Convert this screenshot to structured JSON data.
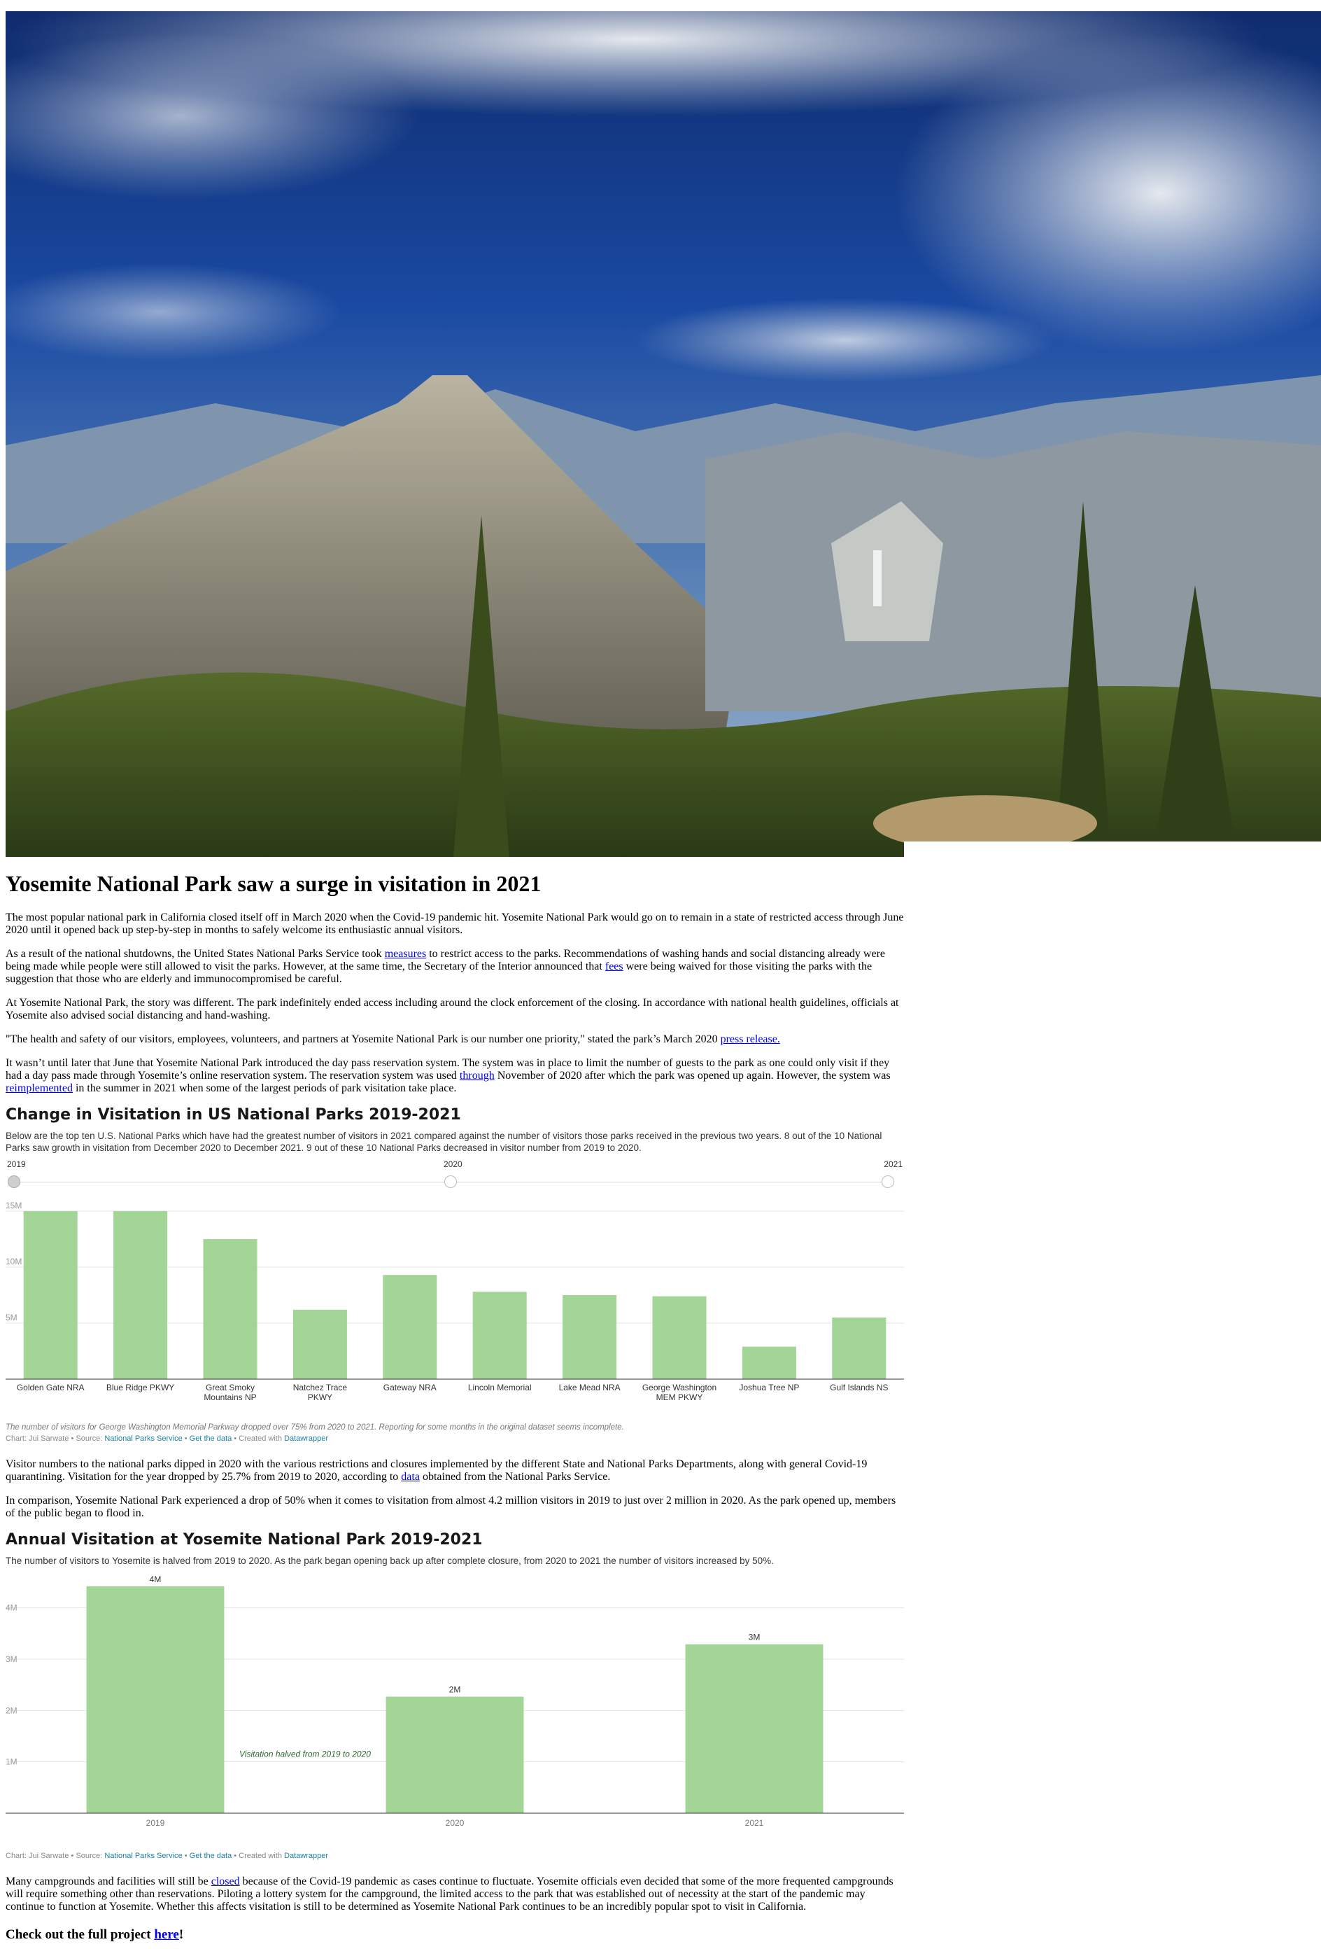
{
  "article": {
    "title": "Yosemite National Park saw a surge in visitation in 2021",
    "p1": "The most popular national park in California closed itself off in March 2020 when the Covid-19 pandemic hit. Yosemite National Park would go on to remain in a state of restricted access through June 2020 until it opened back up step-by-step in months to safely welcome its enthusiastic annual visitors.",
    "p2": {
      "a": "As a result of the national shutdowns, the United States National Parks Service took ",
      "link1": "measures",
      "b": " to restrict access to the parks. Recommendations of washing hands and social distancing already were being made while people were still allowed to visit the parks. However, at the same time, the Secretary of the Interior announced that ",
      "link2": "fees",
      "c": " were being waived for those visiting the parks with the suggestion that those who are elderly and immunocompromised be careful."
    },
    "p3": "At Yosemite National Park, the story was different. The park indefinitely ended access including around the clock enforcement of the closing. In accordance with national health guidelines, officials at Yosemite also advised social distancing and hand-washing.",
    "p4": {
      "a": "\"The health and safety of our visitors, employees, volunteers, and partners at Yosemite National Park is our number one priority,\" stated the park’s March 2020 ",
      "link": "press release."
    },
    "p5": {
      "a": "It wasn’t until later that June that Yosemite National Park introduced the day pass reservation system. The system was in place to limit the number of guests to the park as one could only visit if they had a day pass made through Yosemite’s online reservation system. The reservation system was used ",
      "link1": "through",
      "b": " November of 2020 after which the park was opened up again. However, the system was ",
      "link2": "reimplemented",
      "c": " in the summer in 2021 when some of the largest periods of park visitation take place."
    },
    "p6": {
      "a": "Visitor numbers to the national parks dipped in 2020 with the various restrictions and closures implemented by the different State and National Parks Departments, along with general Covid-19 quarantining. Visitation for the year dropped by 25.7% from 2019 to 2020, according to ",
      "link": "data",
      "b": " obtained from the National Parks Service."
    },
    "p7": "In comparison, Yosemite National Park experienced a drop of 50% when it comes to visitation from almost 4.2 million visitors in 2019 to just over 2 million in 2020. As the park opened up, members of the public began to flood in.",
    "p8": {
      "a": "Many campgrounds and facilities will still be ",
      "link": "closed",
      "b": " because of the Covid-19 pandemic as cases continue to fluctuate. Yosemite officials even decided that some of the more frequented campgrounds will require something other than reservations. Piloting a lottery system for the campground, the limited access to the park that was established out of necessity at the start of the pandemic may continue to function at Yosemite. Whether this affects visitation is still to be determined as Yosemite National Park continues to be an incredibly popular spot to visit in California."
    },
    "cta": {
      "a": "Check out the full project ",
      "link": "here",
      "b": "!"
    }
  },
  "chart1": {
    "title": "Change in Visitation in US National Parks 2019-2021",
    "desc": "Below are the top ten U.S. National Parks which have had the greatest number of visitors in 2021 compared against the number of visitors those parks received in the previous two years. 8 out of the 10 National Parks saw growth in visitation from December 2020 to December 2021. 9 out of these 10 National Parks decreased in visitor number from 2019 to 2020.",
    "slider_years": [
      "2019",
      "2020",
      "2021"
    ],
    "slider_selected": "2019",
    "notes": "The number of visitors for George Washington Memorial Parkway dropped over 75% from 2020 to 2021. Reporting for some months in the original dataset seems incomplete.",
    "footer": {
      "chart": "Chart: Jui Sarwate • Source: ",
      "source": "National Parks Service",
      "sep1": " • ",
      "getdata": "Get the data",
      "sep2": " • Created with ",
      "tool": "Datawrapper"
    }
  },
  "chart2": {
    "title": "Annual Visitation at Yosemite National Park 2019-2021",
    "desc": "The number of visitors to Yosemite is halved from 2019 to 2020. As the park began opening back up after complete closure, from 2020 to 2021 the number of visitors increased by 50%.",
    "annotation": "Visitation halved from 2019 to 2020",
    "footer": {
      "chart": "Chart: Jui Sarwate • Source: ",
      "source": "National Parks Service",
      "sep1": " • ",
      "getdata": "Get the data",
      "sep2": " • Created with ",
      "tool": "Datawrapper"
    }
  },
  "chart_data": [
    {
      "type": "bar",
      "title": "Change in Visitation in US National Parks 2019-2021",
      "categories": [
        "Golden Gate NRA",
        "Blue Ridge PKWY",
        "Great Smoky Mountains NP",
        "Natchez Trace PKWY",
        "Gateway NRA",
        "Lincoln Memorial",
        "Lake Mead NRA",
        "George Washington MEM PKWY",
        "Joshua Tree NP",
        "Gulf Islands NS"
      ],
      "category_lines": [
        [
          "Golden Gate NRA"
        ],
        [
          "Blue Ridge PKWY"
        ],
        [
          "Great Smoky",
          "Mountains NP"
        ],
        [
          "Natchez Trace",
          "PKWY"
        ],
        [
          "Gateway NRA"
        ],
        [
          "Lincoln Memorial"
        ],
        [
          "Lake Mead NRA"
        ],
        [
          "George Washington",
          "MEM PKWY"
        ],
        [
          "Joshua Tree NP"
        ],
        [
          "Gulf Islands NS"
        ]
      ],
      "series": [
        {
          "values": [
            15.0,
            15.0,
            12.5,
            6.2,
            9.3,
            7.8,
            7.5,
            7.4,
            2.9,
            5.5
          ]
        }
      ],
      "ylim": [
        0,
        15
      ],
      "yticks": [
        5,
        10,
        15
      ],
      "ytick_labels": [
        "5M",
        "10M",
        "15M"
      ],
      "bar_color": "#a3d596",
      "grid": true
    },
    {
      "type": "bar",
      "title": "Annual Visitation at Yosemite National Park 2019-2021",
      "categories": [
        "2019",
        "2020",
        "2021"
      ],
      "values": [
        4.42,
        2.27,
        3.29
      ],
      "value_labels": [
        "4M",
        "2M",
        "3M"
      ],
      "ylim": [
        0,
        4.5
      ],
      "yticks": [
        1,
        2,
        3,
        4
      ],
      "ytick_labels": [
        "1M",
        "2M",
        "3M",
        "4M"
      ],
      "bar_color": "#a3d596",
      "grid": true
    }
  ]
}
